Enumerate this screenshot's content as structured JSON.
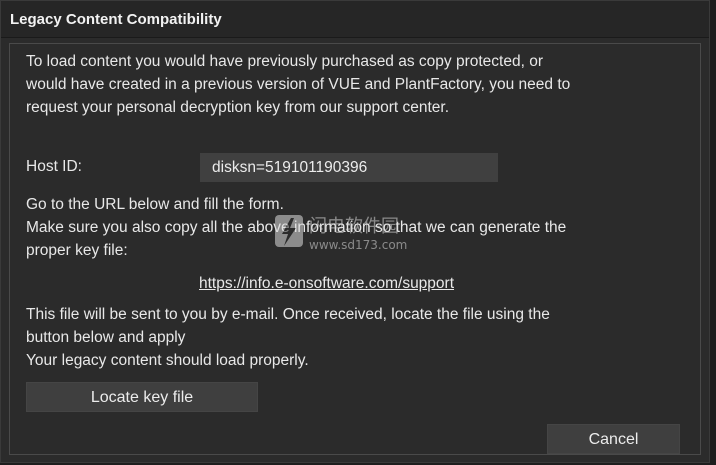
{
  "dialog": {
    "title": "Legacy Content Compatibility",
    "intro": [
      "To load content you would have previously purchased as copy protected, or",
      "would have created in a previous version of VUE and PlantFactory, you need to",
      "request your personal decryption key from our support center."
    ],
    "host_label": "Host ID:",
    "host_value": "disksn=519101190396",
    "instructions": [
      "Go to the URL below and fill the form.",
      "Make sure you also copy all the above information so that we can generate the",
      "proper key file:"
    ],
    "url": "https://info.e-onsoftware.com/support",
    "after": [
      "This file will be sent to you by e-mail. Once received, locate the file using the",
      "button below and apply",
      "Your legacy content should load properly."
    ],
    "locate_label": "Locate key file",
    "cancel_label": "Cancel"
  },
  "watermark": {
    "text": "闪电软件园",
    "url": "www.sd173.com"
  }
}
